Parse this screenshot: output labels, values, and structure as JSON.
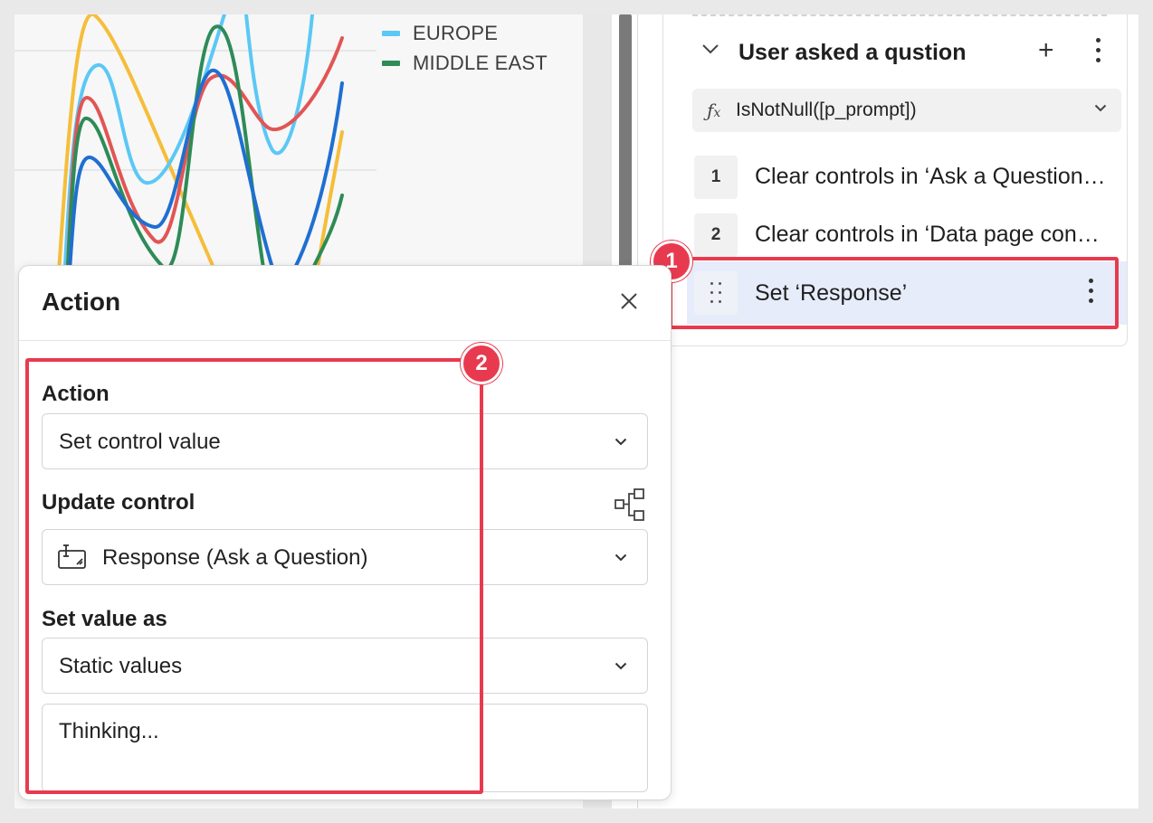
{
  "chart": {
    "legend": [
      {
        "label": "EUROPE",
        "color": "#5bc8f5"
      },
      {
        "label": "MIDDLE EAST",
        "color": "#2e8b57"
      }
    ],
    "line_colors": [
      "#f5be3a",
      "#5bc8f5",
      "#e25555",
      "#2e8b57",
      "#1f6fd1"
    ]
  },
  "rule": {
    "title": "User asked a qustion",
    "formula": "IsNotNull([p_prompt])",
    "steps": [
      {
        "number": "1",
        "label": "Clear controls in ‘Ask a Question…"
      },
      {
        "number": "2",
        "label": "Clear controls in ‘Data page con…"
      },
      {
        "number": "",
        "label": "Set ‘Response’"
      }
    ]
  },
  "modal": {
    "title": "Action",
    "action_label": "Action",
    "action_value": "Set control value",
    "update_label": "Update control",
    "update_value": "Response (Ask a Question)",
    "set_value_label": "Set value as",
    "set_value_value": "Static values",
    "static_text": "Thinking..."
  },
  "callouts": {
    "one": "1",
    "two": "2"
  },
  "colors": {
    "highlight": "#e83a4f",
    "selected_row": "#e6ecfa"
  }
}
